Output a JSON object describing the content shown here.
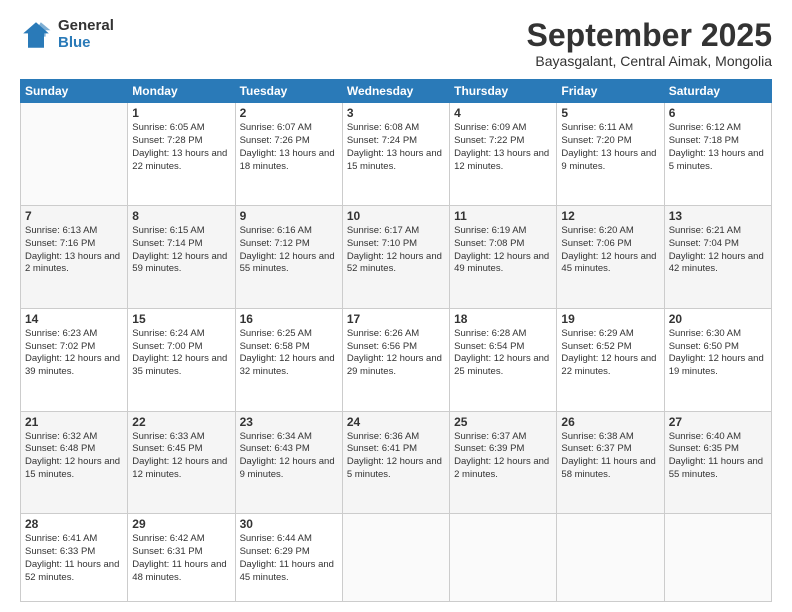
{
  "logo": {
    "general": "General",
    "blue": "Blue"
  },
  "header": {
    "month": "September 2025",
    "location": "Bayasgalant, Central Aimak, Mongolia"
  },
  "weekdays": [
    "Sunday",
    "Monday",
    "Tuesday",
    "Wednesday",
    "Thursday",
    "Friday",
    "Saturday"
  ],
  "weeks": [
    [
      {
        "day": "",
        "sunrise": "",
        "sunset": "",
        "daylight": ""
      },
      {
        "day": "1",
        "sunrise": "Sunrise: 6:05 AM",
        "sunset": "Sunset: 7:28 PM",
        "daylight": "Daylight: 13 hours and 22 minutes."
      },
      {
        "day": "2",
        "sunrise": "Sunrise: 6:07 AM",
        "sunset": "Sunset: 7:26 PM",
        "daylight": "Daylight: 13 hours and 18 minutes."
      },
      {
        "day": "3",
        "sunrise": "Sunrise: 6:08 AM",
        "sunset": "Sunset: 7:24 PM",
        "daylight": "Daylight: 13 hours and 15 minutes."
      },
      {
        "day": "4",
        "sunrise": "Sunrise: 6:09 AM",
        "sunset": "Sunset: 7:22 PM",
        "daylight": "Daylight: 13 hours and 12 minutes."
      },
      {
        "day": "5",
        "sunrise": "Sunrise: 6:11 AM",
        "sunset": "Sunset: 7:20 PM",
        "daylight": "Daylight: 13 hours and 9 minutes."
      },
      {
        "day": "6",
        "sunrise": "Sunrise: 6:12 AM",
        "sunset": "Sunset: 7:18 PM",
        "daylight": "Daylight: 13 hours and 5 minutes."
      }
    ],
    [
      {
        "day": "7",
        "sunrise": "Sunrise: 6:13 AM",
        "sunset": "Sunset: 7:16 PM",
        "daylight": "Daylight: 13 hours and 2 minutes."
      },
      {
        "day": "8",
        "sunrise": "Sunrise: 6:15 AM",
        "sunset": "Sunset: 7:14 PM",
        "daylight": "Daylight: 12 hours and 59 minutes."
      },
      {
        "day": "9",
        "sunrise": "Sunrise: 6:16 AM",
        "sunset": "Sunset: 7:12 PM",
        "daylight": "Daylight: 12 hours and 55 minutes."
      },
      {
        "day": "10",
        "sunrise": "Sunrise: 6:17 AM",
        "sunset": "Sunset: 7:10 PM",
        "daylight": "Daylight: 12 hours and 52 minutes."
      },
      {
        "day": "11",
        "sunrise": "Sunrise: 6:19 AM",
        "sunset": "Sunset: 7:08 PM",
        "daylight": "Daylight: 12 hours and 49 minutes."
      },
      {
        "day": "12",
        "sunrise": "Sunrise: 6:20 AM",
        "sunset": "Sunset: 7:06 PM",
        "daylight": "Daylight: 12 hours and 45 minutes."
      },
      {
        "day": "13",
        "sunrise": "Sunrise: 6:21 AM",
        "sunset": "Sunset: 7:04 PM",
        "daylight": "Daylight: 12 hours and 42 minutes."
      }
    ],
    [
      {
        "day": "14",
        "sunrise": "Sunrise: 6:23 AM",
        "sunset": "Sunset: 7:02 PM",
        "daylight": "Daylight: 12 hours and 39 minutes."
      },
      {
        "day": "15",
        "sunrise": "Sunrise: 6:24 AM",
        "sunset": "Sunset: 7:00 PM",
        "daylight": "Daylight: 12 hours and 35 minutes."
      },
      {
        "day": "16",
        "sunrise": "Sunrise: 6:25 AM",
        "sunset": "Sunset: 6:58 PM",
        "daylight": "Daylight: 12 hours and 32 minutes."
      },
      {
        "day": "17",
        "sunrise": "Sunrise: 6:26 AM",
        "sunset": "Sunset: 6:56 PM",
        "daylight": "Daylight: 12 hours and 29 minutes."
      },
      {
        "day": "18",
        "sunrise": "Sunrise: 6:28 AM",
        "sunset": "Sunset: 6:54 PM",
        "daylight": "Daylight: 12 hours and 25 minutes."
      },
      {
        "day": "19",
        "sunrise": "Sunrise: 6:29 AM",
        "sunset": "Sunset: 6:52 PM",
        "daylight": "Daylight: 12 hours and 22 minutes."
      },
      {
        "day": "20",
        "sunrise": "Sunrise: 6:30 AM",
        "sunset": "Sunset: 6:50 PM",
        "daylight": "Daylight: 12 hours and 19 minutes."
      }
    ],
    [
      {
        "day": "21",
        "sunrise": "Sunrise: 6:32 AM",
        "sunset": "Sunset: 6:48 PM",
        "daylight": "Daylight: 12 hours and 15 minutes."
      },
      {
        "day": "22",
        "sunrise": "Sunrise: 6:33 AM",
        "sunset": "Sunset: 6:45 PM",
        "daylight": "Daylight: 12 hours and 12 minutes."
      },
      {
        "day": "23",
        "sunrise": "Sunrise: 6:34 AM",
        "sunset": "Sunset: 6:43 PM",
        "daylight": "Daylight: 12 hours and 9 minutes."
      },
      {
        "day": "24",
        "sunrise": "Sunrise: 6:36 AM",
        "sunset": "Sunset: 6:41 PM",
        "daylight": "Daylight: 12 hours and 5 minutes."
      },
      {
        "day": "25",
        "sunrise": "Sunrise: 6:37 AM",
        "sunset": "Sunset: 6:39 PM",
        "daylight": "Daylight: 12 hours and 2 minutes."
      },
      {
        "day": "26",
        "sunrise": "Sunrise: 6:38 AM",
        "sunset": "Sunset: 6:37 PM",
        "daylight": "Daylight: 11 hours and 58 minutes."
      },
      {
        "day": "27",
        "sunrise": "Sunrise: 6:40 AM",
        "sunset": "Sunset: 6:35 PM",
        "daylight": "Daylight: 11 hours and 55 minutes."
      }
    ],
    [
      {
        "day": "28",
        "sunrise": "Sunrise: 6:41 AM",
        "sunset": "Sunset: 6:33 PM",
        "daylight": "Daylight: 11 hours and 52 minutes."
      },
      {
        "day": "29",
        "sunrise": "Sunrise: 6:42 AM",
        "sunset": "Sunset: 6:31 PM",
        "daylight": "Daylight: 11 hours and 48 minutes."
      },
      {
        "day": "30",
        "sunrise": "Sunrise: 6:44 AM",
        "sunset": "Sunset: 6:29 PM",
        "daylight": "Daylight: 11 hours and 45 minutes."
      },
      {
        "day": "",
        "sunrise": "",
        "sunset": "",
        "daylight": ""
      },
      {
        "day": "",
        "sunrise": "",
        "sunset": "",
        "daylight": ""
      },
      {
        "day": "",
        "sunrise": "",
        "sunset": "",
        "daylight": ""
      },
      {
        "day": "",
        "sunrise": "",
        "sunset": "",
        "daylight": ""
      }
    ]
  ]
}
